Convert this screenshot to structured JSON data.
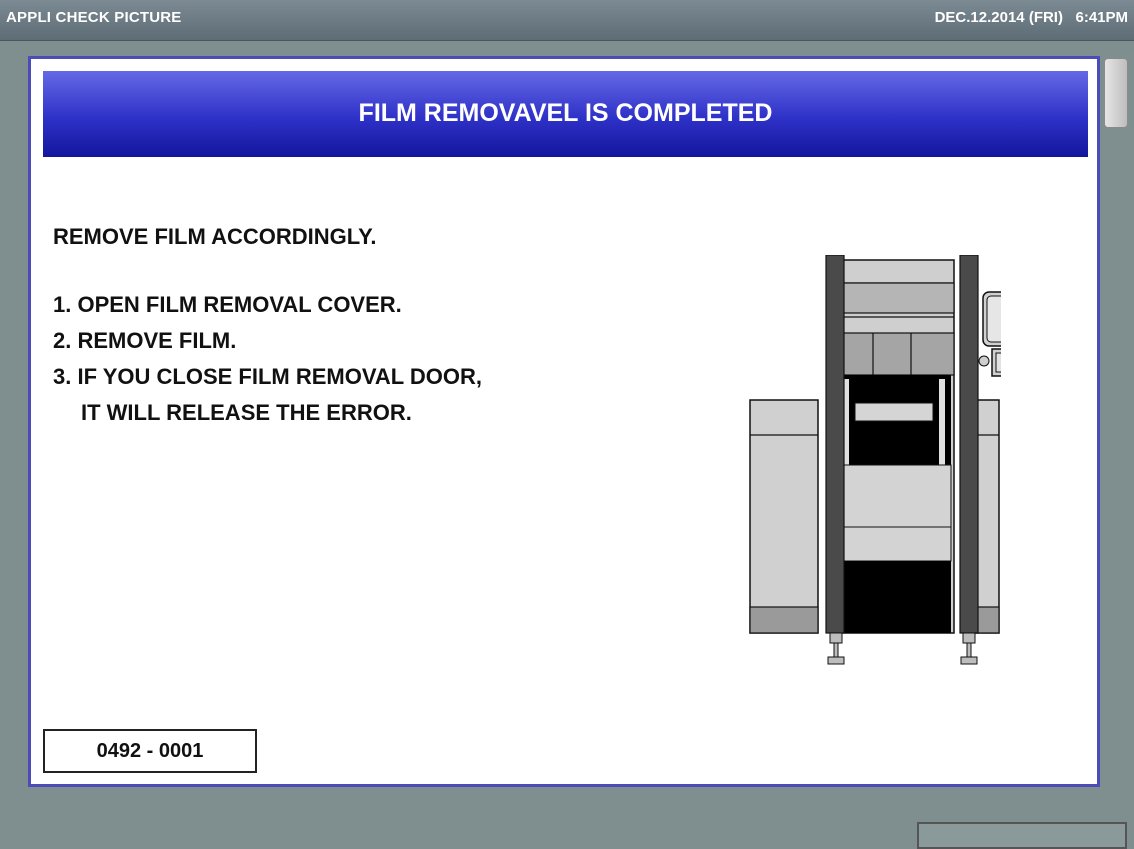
{
  "header": {
    "app_title": "APPLI CHECK PICTURE",
    "datetime": "DEC.12.2014 (FRI)   6:41PM"
  },
  "dialog": {
    "title": "FILM REMOVAVEL IS COMPLETED",
    "intro": "REMOVE FILM ACCORDINGLY.",
    "steps": [
      "1. OPEN FILM REMOVAL COVER.",
      "2. REMOVE FILM.",
      "3. IF YOU CLOSE FILM REMOVAL DOOR,"
    ],
    "step3_continuation": "IT WILL RELEASE THE ERROR.",
    "error_code": "0492 - 0001",
    "illustration": "machine-illustration"
  },
  "colors": {
    "background": "#7f8f8f",
    "title_bar": "#2e31c7",
    "dialog_border": "#4b4cb8"
  }
}
